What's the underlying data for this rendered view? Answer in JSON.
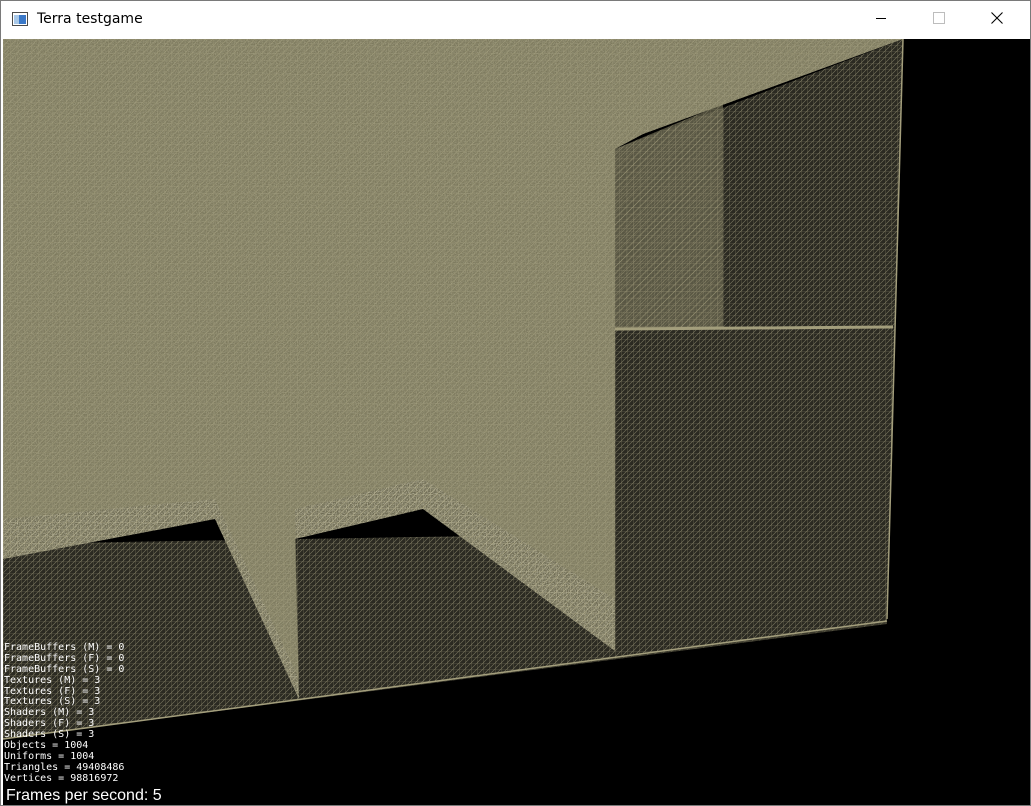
{
  "window": {
    "title": "Terra testgame"
  },
  "icons": {
    "app": "app-window-icon",
    "minimize": "minimize-icon",
    "maximize": "maximize-icon",
    "close": "close-icon"
  },
  "colors": {
    "terrain": "#8a8667",
    "terrain_dark": "#5e5b44",
    "background": "#000000",
    "overlay_text": "#ffffff"
  },
  "stats": [
    "FrameBuffers (M) = 0",
    "FrameBuffers (F) = 0",
    "FrameBuffers (S) = 0",
    "Textures (M) = 3",
    "Textures (F) = 3",
    "Textures (S) = 3",
    "Shaders (M) = 3",
    "Shaders (F) = 3",
    "Shaders (S) = 3",
    "Objects = 1004",
    "Uniforms = 1004",
    "Triangles = 49408486",
    "Vertices = 98816972"
  ],
  "fps_text": "Frames per second: 5"
}
